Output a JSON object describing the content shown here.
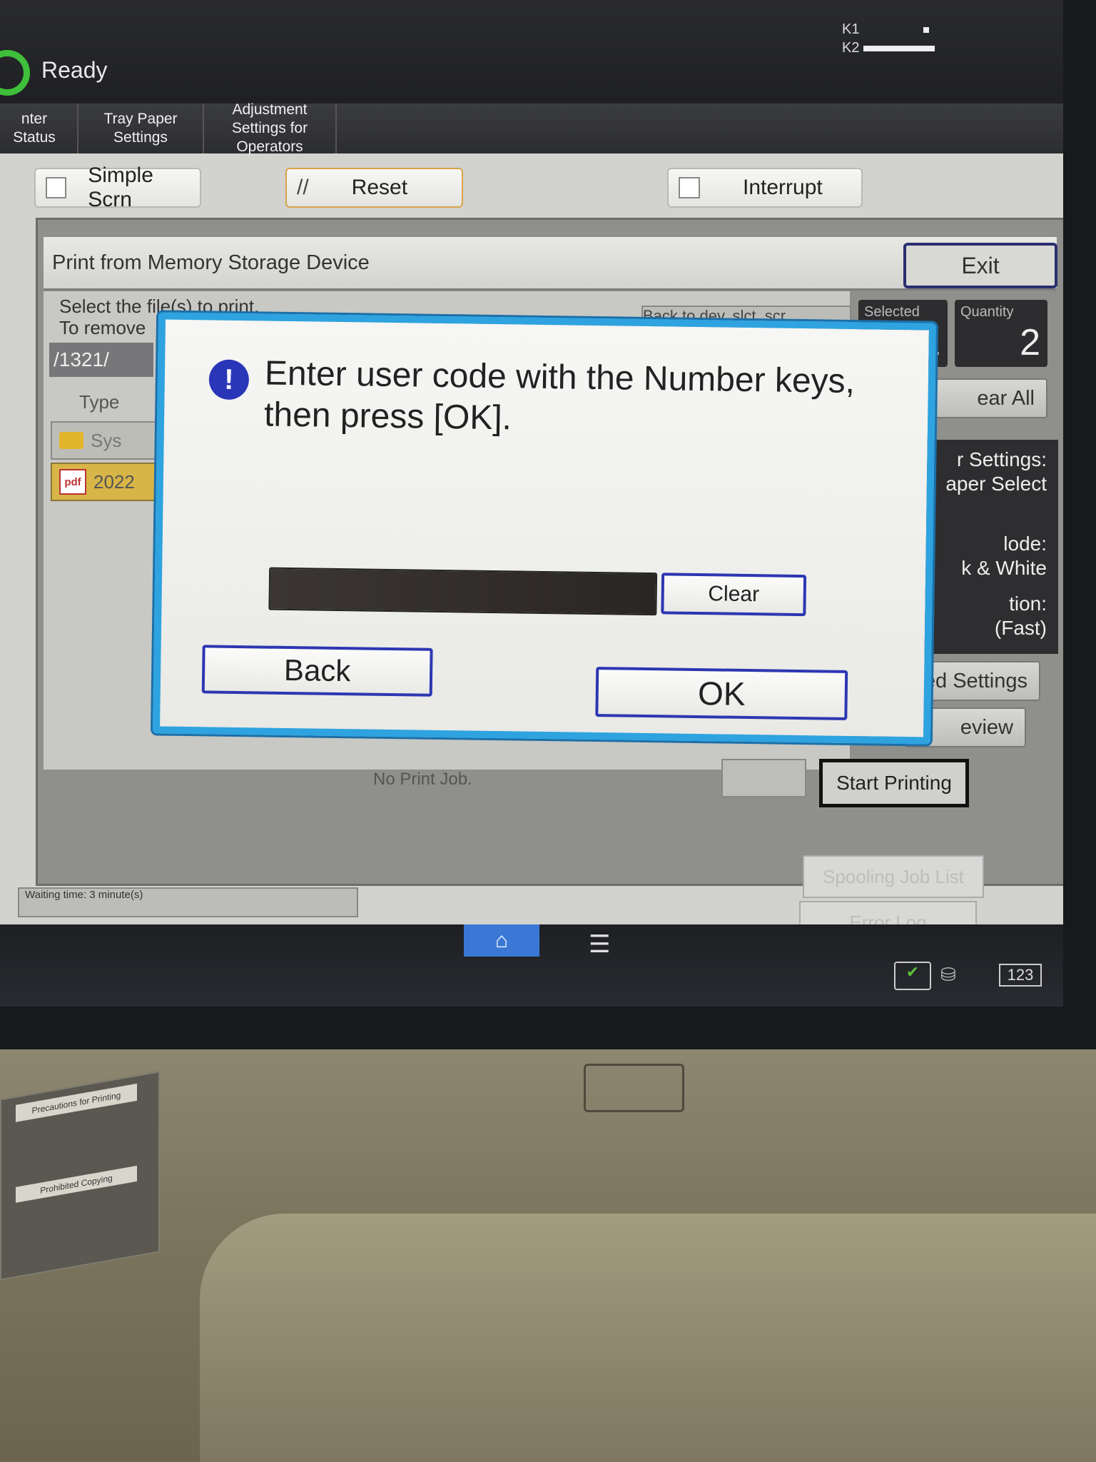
{
  "status": {
    "ready_text": "Ready"
  },
  "toner": {
    "k1": "K1",
    "k2": "K2"
  },
  "tabs": [
    {
      "label": "nter Status"
    },
    {
      "label": "Tray Paper Settings"
    },
    {
      "label": "Adjustment Settings for Operators"
    }
  ],
  "top_buttons": {
    "simple": "Simple Scrn",
    "reset": "Reset",
    "interrupt": "Interrupt"
  },
  "app": {
    "title": "Print from Memory Storage Device",
    "exit": "Exit",
    "prompt1": "Select the file(s) to print.",
    "prompt2": "To remove",
    "path": "/1321/",
    "type_header": "Type",
    "rows": [
      {
        "name": "Sys"
      },
      {
        "name": "2022"
      }
    ],
    "back_to_dev": "Back to dev. slct. scr.",
    "selected_label": "Selected",
    "selected_value": "1",
    "quantity_label": "Quantity",
    "quantity_value": "2",
    "clear_all": "ear All",
    "settings": {
      "line1": "r Settings:",
      "line2": "aper Select",
      "line3": "lode:",
      "line4": "k & White",
      "line5": "tion:",
      "line6": "(Fast)"
    },
    "adv_settings": "ed Settings",
    "preview": "eview",
    "start_printing": "Start Printing",
    "no_print_job": "No Print Job.",
    "spooling": "Spooling Job List",
    "error_log": "Error Log"
  },
  "footer": {
    "waiting": "Waiting time: 3 minute(s)",
    "kbd": "123"
  },
  "dialog": {
    "message": "Enter user code with the Number keys, then press [OK].",
    "clear": "Clear",
    "back": "Back",
    "ok": "OK",
    "code_value": ""
  },
  "sticker": {
    "heading1": "Precautions for Printing",
    "heading2": "Prohibited Copying"
  }
}
